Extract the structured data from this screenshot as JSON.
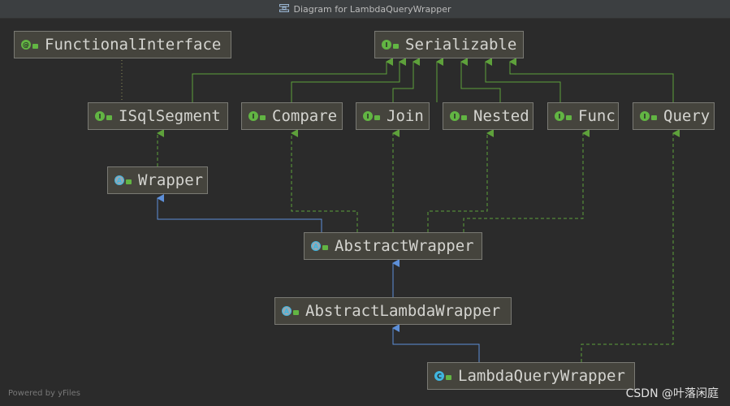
{
  "window": {
    "title": "Diagram for LambdaQueryWrapper",
    "title_icon": "diagram-icon"
  },
  "nodes": {
    "functional_interface": {
      "label": "FunctionalInterface",
      "badge": "@",
      "kind": "annotation"
    },
    "serializable": {
      "label": "Serializable",
      "badge": "I",
      "kind": "interface"
    },
    "isqlsegment": {
      "label": "ISqlSegment",
      "badge": "I",
      "kind": "interface"
    },
    "compare": {
      "label": "Compare",
      "badge": "I",
      "kind": "interface"
    },
    "join": {
      "label": "Join",
      "badge": "I",
      "kind": "interface"
    },
    "nested": {
      "label": "Nested",
      "badge": "I",
      "kind": "interface"
    },
    "func": {
      "label": "Func",
      "badge": "I",
      "kind": "interface"
    },
    "query": {
      "label": "Query",
      "badge": "I",
      "kind": "interface"
    },
    "wrapper": {
      "label": "Wrapper",
      "badge": "A",
      "kind": "abstract-class"
    },
    "abstract_wrapper": {
      "label": "AbstractWrapper",
      "badge": "A",
      "kind": "abstract-class"
    },
    "abstract_lambda_wrapper": {
      "label": "AbstractLambdaWrapper",
      "badge": "A",
      "kind": "abstract-class"
    },
    "lambda_query_wrapper": {
      "label": "LambdaQueryWrapper",
      "badge": "C",
      "kind": "class"
    }
  },
  "colors": {
    "background": "#2b2b2b",
    "node_fill": "#45443d",
    "node_border": "#7a7a74",
    "extends_edge": "#5d8fd8",
    "implements_edge": "#5ea13b",
    "annotation_edge": "#8d8d5a"
  },
  "footer": {
    "left": "Powered by yFiles",
    "right": "CSDN @叶落闲庭"
  }
}
